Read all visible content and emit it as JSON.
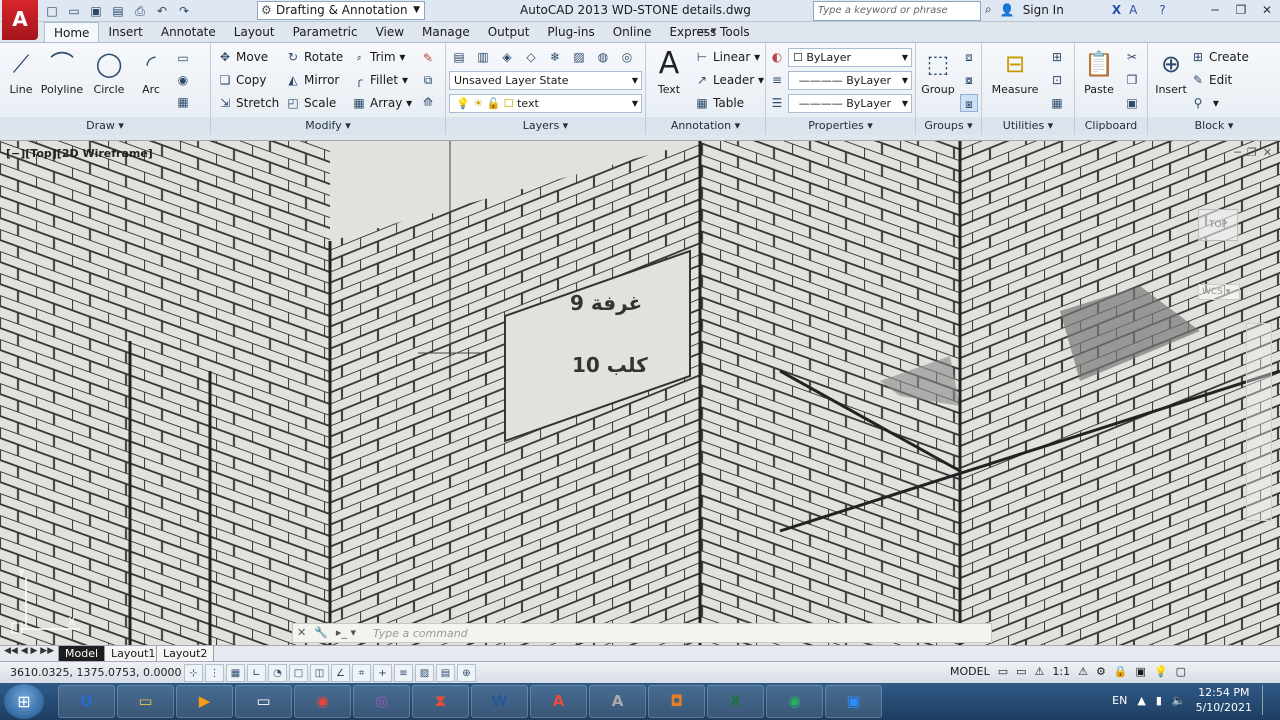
{
  "titlebar": {
    "logo": "A",
    "workspace": "Drafting & Annotation",
    "title": "AutoCAD 2013    WD-STONE details.dwg",
    "search_placeholder": "Type a keyword or phrase",
    "sign_in": "Sign In"
  },
  "tabs": [
    "Home",
    "Insert",
    "Annotate",
    "Layout",
    "Parametric",
    "View",
    "Manage",
    "Output",
    "Plug-ins",
    "Online",
    "Express Tools"
  ],
  "ribbon": {
    "draw": {
      "label": "Draw",
      "line": "Line",
      "polyline": "Polyline",
      "circle": "Circle",
      "arc": "Arc"
    },
    "modify": {
      "label": "Modify",
      "move": "Move",
      "rotate": "Rotate",
      "trim": "Trim",
      "copy": "Copy",
      "mirror": "Mirror",
      "fillet": "Fillet",
      "stretch": "Stretch",
      "scale": "Scale",
      "array": "Array"
    },
    "layers": {
      "label": "Layers",
      "state": "Unsaved Layer State",
      "current": "text"
    },
    "annotation": {
      "label": "Annotation",
      "text": "Text",
      "linear": "Linear",
      "leader": "Leader",
      "table": "Table"
    },
    "properties": {
      "label": "Properties",
      "color": "ByLayer",
      "linetype": "ByLayer",
      "lineweight": "ByLayer"
    },
    "groups": {
      "label": "Groups",
      "group": "Group"
    },
    "utilities": {
      "label": "Utilities",
      "measure": "Measure"
    },
    "clipboard": {
      "label": "Clipboard",
      "paste": "Paste"
    },
    "block": {
      "label": "Block",
      "insert": "Insert",
      "create": "Create",
      "edit": "Edit"
    }
  },
  "viewport": {
    "label": "[−][Top][2D Wireframe]",
    "navcube": "TOP",
    "wcs": "WCS",
    "text1": "9 غرفة",
    "text2": "10 كلب",
    "ucs_y": "Y",
    "ucs_x": "X"
  },
  "command": {
    "placeholder": "Type a command"
  },
  "layouts": [
    "Model",
    "Layout1",
    "Layout2"
  ],
  "status": {
    "coords": "3610.0325, 1375.0753, 0.0000",
    "model": "MODEL",
    "scale": "1:1"
  },
  "taskbar": {
    "lang": "EN",
    "time": "12:54 PM",
    "date": "5/10/2021"
  }
}
